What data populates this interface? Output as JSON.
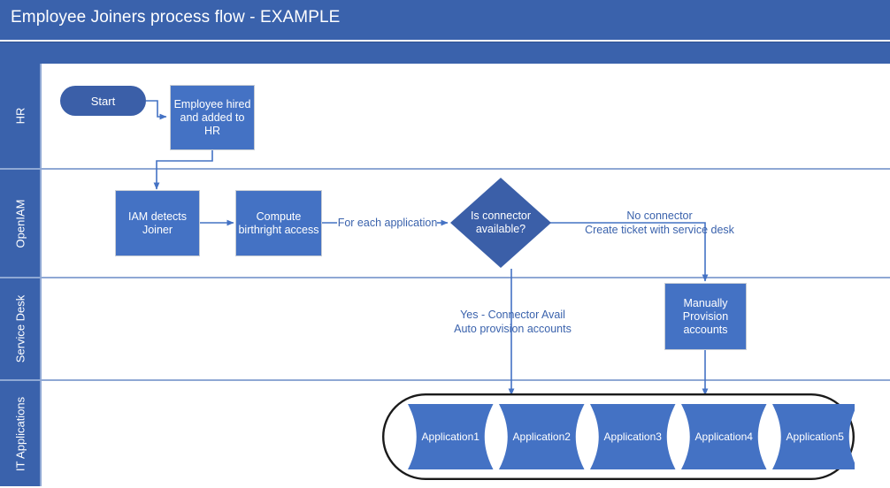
{
  "header": {
    "title": "Employee Joiners process flow - EXAMPLE"
  },
  "colors": {
    "title_bar": "#3A62AC",
    "lane_header": "#3A62AC",
    "process_fill": "#4472C4",
    "terminator_fill": "#3B5FA8",
    "decision_fill": "#3B5FA8",
    "connector": "#4472C4",
    "edge_label_text": "#3A62AC",
    "lane_divider": "#8fa8d4",
    "apps_container_stroke": "#1a1a1a"
  },
  "lanes": [
    {
      "id": "hr",
      "label": "HR"
    },
    {
      "id": "openiam",
      "label": "OpenIAM"
    },
    {
      "id": "service-desk",
      "label": "Service Desk"
    },
    {
      "id": "it-applications",
      "label": "IT Applications"
    }
  ],
  "nodes": {
    "start": {
      "label": "Start",
      "shape": "terminator"
    },
    "employee_hired": {
      "label": "Employee hired\nand added to HR",
      "shape": "process"
    },
    "iam_detects": {
      "label": "IAM detects\nJoiner",
      "shape": "process"
    },
    "compute_birthright": {
      "label": "Compute\nbirthright access",
      "shape": "process"
    },
    "is_connector": {
      "label": "Is connector\navailable?",
      "shape": "decision"
    },
    "manual_provision": {
      "label": "Manually\nProvision\naccounts",
      "shape": "process"
    }
  },
  "edge_labels": {
    "for_each_application": "For each application",
    "no_connector": "No connector\nCreate ticket with service desk",
    "yes_connector": "Yes - Connector Avail\nAuto provision accounts"
  },
  "applications": [
    {
      "label": "Application1"
    },
    {
      "label": "Application2"
    },
    {
      "label": "Application3"
    },
    {
      "label": "Application4"
    },
    {
      "label": "Application5"
    }
  ]
}
